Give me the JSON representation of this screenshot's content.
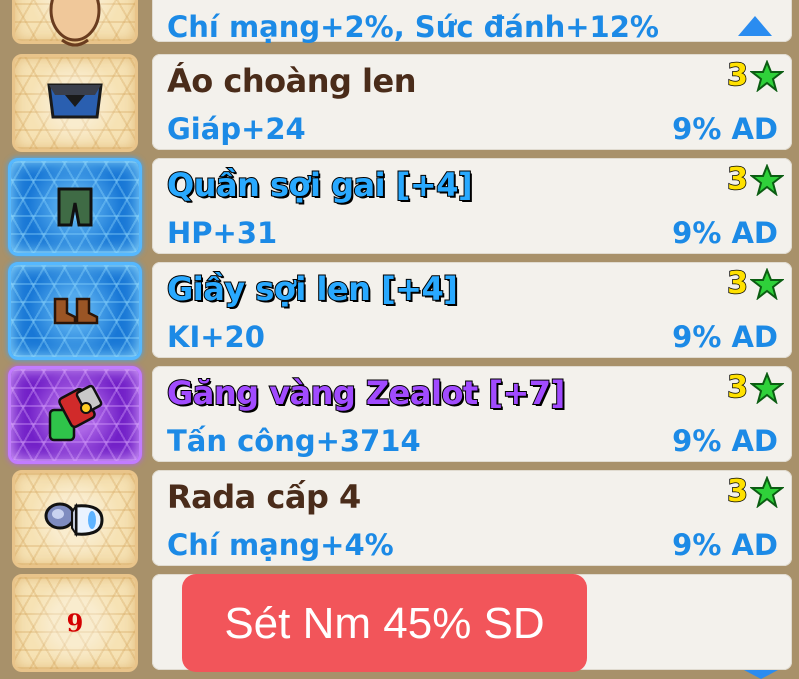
{
  "top_row": {
    "stat": "Chí mạng+2%, Sức đánh+12%"
  },
  "items": [
    {
      "name": "Áo choàng len",
      "stat": "Giáp+24",
      "ad": "9% AD",
      "stars": "3",
      "icon": "cloak-icon",
      "frame": "normal"
    },
    {
      "name": "Quần sợi gai [+4]",
      "stat": "HP+31",
      "ad": "9% AD",
      "stars": "3",
      "icon": "pants-icon",
      "frame": "blue"
    },
    {
      "name": "Giầy sợi len [+4]",
      "stat": "KI+20",
      "ad": "9% AD",
      "stars": "3",
      "icon": "boots-icon",
      "frame": "blue"
    },
    {
      "name": "Găng vàng Zealot [+7]",
      "stat": "Tấn công+3714",
      "ad": "9% AD",
      "stars": "3",
      "icon": "gloves-icon",
      "frame": "purple"
    },
    {
      "name": "Rada cấp 4",
      "stat": "Chí mạng+4%",
      "ad": "9% AD",
      "stars": "3",
      "icon": "radar-icon",
      "frame": "normal"
    }
  ],
  "bottom_slot": {
    "count": "9"
  },
  "overlay": {
    "text": "Sét Nm 45% SD"
  },
  "colors": {
    "stat_blue": "#1c8ae6",
    "name_brown": "#4a2c1a",
    "star_green": "#2fd13a",
    "overlay_red": "#f2555a"
  }
}
